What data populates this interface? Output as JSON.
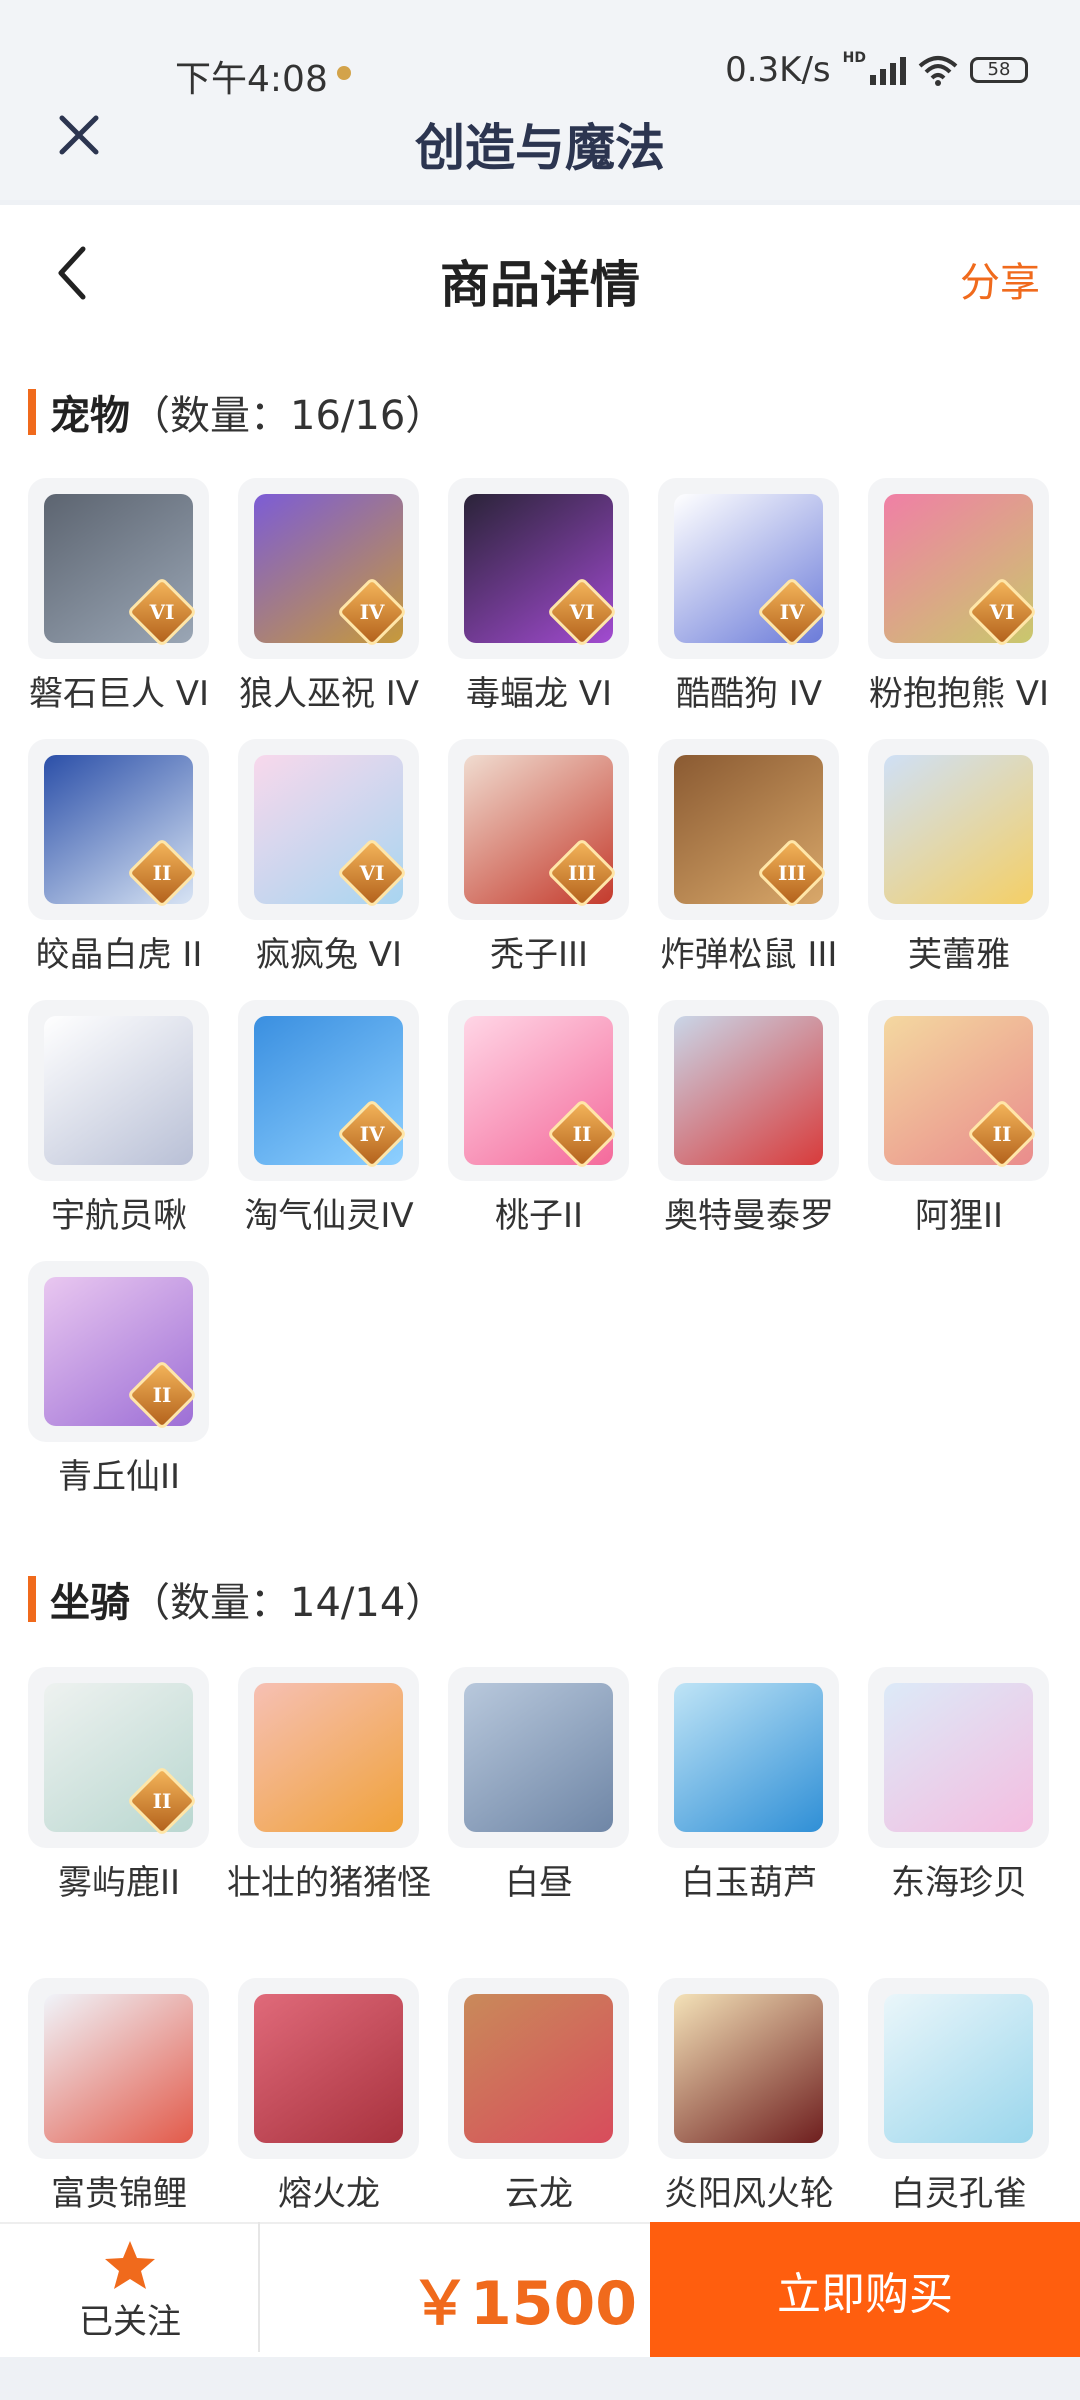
{
  "status_bar": {
    "time": "下午4:08",
    "network_speed": "0.3K/s",
    "network_type": "HD",
    "battery": "58"
  },
  "app_header": {
    "title": "创造与魔法"
  },
  "nav": {
    "title": "商品详情",
    "share_label": "分享"
  },
  "colors": {
    "accent": "#f06a1c",
    "buy_button": "#ff5e0e",
    "tile_bg": "#f3f4f6"
  },
  "pets": {
    "name": "宠物",
    "count": "（数量：16/16）",
    "items": [
      {
        "name": "磐石巨人 VI",
        "tier": "VI",
        "art": [
          "#5c6470",
          "#9aa6b5"
        ]
      },
      {
        "name": "狼人巫祝 IV",
        "tier": "IV",
        "art": [
          "#7c5cd6",
          "#c79a3a"
        ]
      },
      {
        "name": "毒蝠龙 VI",
        "tier": "VI",
        "art": [
          "#2a2338",
          "#a24bd1"
        ]
      },
      {
        "name": "酷酷狗 IV",
        "tier": "IV",
        "art": [
          "#ffffff",
          "#6b7bd9"
        ]
      },
      {
        "name": "粉抱抱熊 VI",
        "tier": "VI",
        "art": [
          "#f07fa6",
          "#c9c86c"
        ]
      },
      {
        "name": "皎晶白虎 II",
        "tier": "II",
        "art": [
          "#2b4fa8",
          "#d8e4f4"
        ]
      },
      {
        "name": "疯疯兔 VI",
        "tier": "VI",
        "art": [
          "#f8d8ec",
          "#a8d5f0"
        ]
      },
      {
        "name": "秃子III",
        "tier": "III",
        "art": [
          "#f0dcd0",
          "#c43a2c"
        ]
      },
      {
        "name": "炸弹松鼠 III",
        "tier": "III",
        "art": [
          "#8a5a32",
          "#d9a86a"
        ]
      },
      {
        "name": "芙蕾雅",
        "tier": "",
        "art": [
          "#cfe0f6",
          "#f4cf66"
        ]
      },
      {
        "name": "宇航员啾",
        "tier": "",
        "art": [
          "#ffffff",
          "#b9c0d6"
        ]
      },
      {
        "name": "淘气仙灵IV",
        "tier": "IV",
        "art": [
          "#3a8fe0",
          "#8ed0ff"
        ]
      },
      {
        "name": "桃子II",
        "tier": "II",
        "art": [
          "#ffd6e6",
          "#f46a9b"
        ]
      },
      {
        "name": "奥特曼泰罗",
        "tier": "",
        "art": [
          "#c9d6e8",
          "#d83b3b"
        ]
      },
      {
        "name": "阿狸II",
        "tier": "II",
        "art": [
          "#f4d8a0",
          "#e98c8c"
        ]
      },
      {
        "name": "青丘仙II",
        "tier": "II",
        "art": [
          "#e9c7f0",
          "#9d6fd6"
        ]
      }
    ]
  },
  "mounts": {
    "name": "坐骑",
    "count": "（数量：14/14）",
    "items": [
      {
        "name": "雾屿鹿II",
        "tier": "II",
        "art": [
          "#eef2f0",
          "#b9d7d0"
        ]
      },
      {
        "name": "壮壮的猪猪怪",
        "tier": "",
        "art": [
          "#f6c0b4",
          "#f0a23a"
        ]
      },
      {
        "name": "白昼",
        "tier": "",
        "art": [
          "#b8c8dc",
          "#6f86a6"
        ]
      },
      {
        "name": "白玉葫芦",
        "tier": "",
        "art": [
          "#bfe4f6",
          "#2f8fd6"
        ]
      },
      {
        "name": "东海珍贝",
        "tier": "",
        "art": [
          "#dceaf8",
          "#f4bde0"
        ]
      },
      {
        "name": "富贵锦鲤",
        "tier": "",
        "art": [
          "#f0f4fa",
          "#e25a4a"
        ]
      },
      {
        "name": "熔火龙",
        "tier": "",
        "art": [
          "#e06a7a",
          "#a8323e"
        ]
      },
      {
        "name": "云龙",
        "tier": "",
        "art": [
          "#c98a5a",
          "#d84c5c"
        ]
      },
      {
        "name": "炎阳风火轮",
        "tier": "",
        "art": [
          "#f4e2b8",
          "#6e1e1e"
        ]
      },
      {
        "name": "白灵孔雀",
        "tier": "",
        "art": [
          "#eaf6fa",
          "#9ad6ec"
        ]
      }
    ]
  },
  "bottom_bar": {
    "follow_label": "已关注",
    "price": "￥1500",
    "buy_label": "立即购买"
  }
}
